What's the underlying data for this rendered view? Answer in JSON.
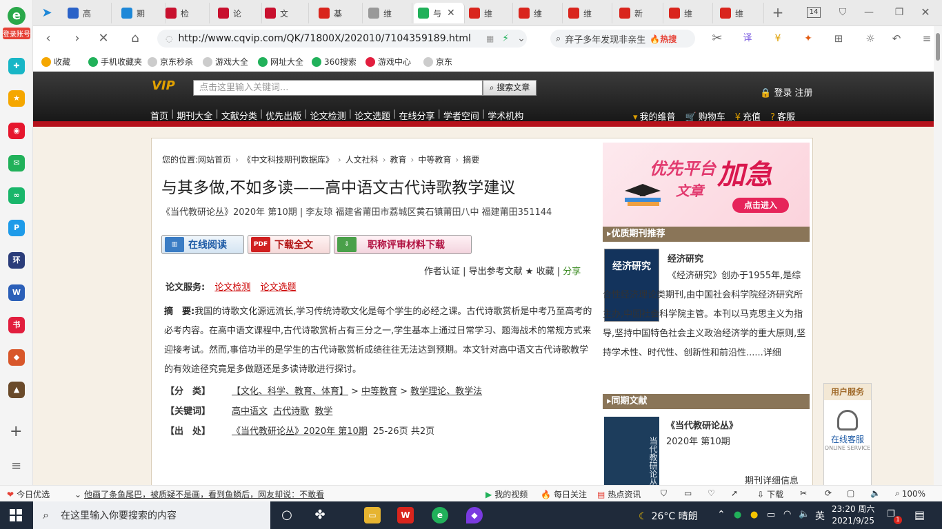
{
  "sidebar": {
    "account_label": "登录账号",
    "apps": [
      {
        "name": "translate",
        "color": "#18b6c6",
        "glyph": "✚"
      },
      {
        "name": "favorites",
        "color": "#f5a700",
        "glyph": "★"
      },
      {
        "name": "weibo",
        "color": "#e6162d",
        "glyph": "◉"
      },
      {
        "name": "mail",
        "color": "#21b15a",
        "glyph": "✉"
      },
      {
        "name": "link",
        "color": "#19b66a",
        "glyph": "∞"
      },
      {
        "name": "p-app",
        "color": "#1e9be9",
        "glyph": "P"
      },
      {
        "name": "huanqiu",
        "color": "#2b3d7a",
        "glyph": "环"
      },
      {
        "name": "word",
        "color": "#2b5fb8",
        "glyph": "W"
      },
      {
        "name": "xiaohongshu",
        "color": "#e21e3e",
        "glyph": "书"
      },
      {
        "name": "game1",
        "color": "#d8572a",
        "glyph": "◆"
      },
      {
        "name": "game2",
        "color": "#6a4a2a",
        "glyph": "▲"
      }
    ],
    "add_label": "+",
    "menu_label": "≡"
  },
  "tabs": [
    {
      "label": "高",
      "color": "#2a62c8"
    },
    {
      "label": "期",
      "color": "#1e88d8"
    },
    {
      "label": "检",
      "color": "#c8102e"
    },
    {
      "label": "论",
      "color": "#c8102e"
    },
    {
      "label": "文",
      "color": "#c8102e"
    },
    {
      "label": "基",
      "color": "#d9251d"
    },
    {
      "label": "维",
      "color": "#999999"
    },
    {
      "label": "与",
      "color": "#21b15a"
    },
    {
      "label": "维",
      "color": "#d9251d"
    },
    {
      "label": "维",
      "color": "#d9251d"
    },
    {
      "label": "维",
      "color": "#d9251d"
    },
    {
      "label": "新",
      "color": "#d9251d"
    },
    {
      "label": "维",
      "color": "#d9251d"
    },
    {
      "label": "维",
      "color": "#d9251d"
    }
  ],
  "tabbar": {
    "new_tab": "+",
    "tab_count": "14"
  },
  "address": {
    "url": "http://www.cqvip.com/QK/71800X/202010/7104359189.html",
    "search_text": "弃子多年发现非亲生",
    "hot_label": "🔥热搜"
  },
  "bookmarks": [
    {
      "label": "收藏",
      "color": "#f5a700"
    },
    {
      "label": "手机收藏夹",
      "color": "#21b15a"
    },
    {
      "label": "京东秒杀",
      "color": "#cccccc"
    },
    {
      "label": "游戏大全",
      "color": "#cccccc"
    },
    {
      "label": "网址大全",
      "color": "#21b15a"
    },
    {
      "label": "360搜索",
      "color": "#21b15a"
    },
    {
      "label": "游戏中心",
      "color": "#e21e3e"
    },
    {
      "label": "京东",
      "color": "#cccccc"
    }
  ],
  "site": {
    "logo": "VIP",
    "search_placeholder": "点击这里输入关键词...",
    "search_button": "搜索文章",
    "login": "登录",
    "register": "注册",
    "nav": [
      "首页",
      "期刊大全",
      "文献分类",
      "优先出版",
      "论文检测",
      "论文选题",
      "在线分享",
      "学者空间",
      "学术机构"
    ],
    "user_nav": [
      "我的维普",
      "购物车",
      "充值",
      "客服"
    ]
  },
  "article": {
    "breadcrumb_prefix": "您的位置:",
    "breadcrumb": [
      "网站首页",
      "《中文科技期刊数据库》",
      "人文社科",
      "教育",
      "中等教育",
      "摘要"
    ],
    "title": "与其多做,不如多读——高中语文古代诗歌教学建议",
    "source_line": "《当代教研论丛》2020年 第10期 | 李友琼   福建省莆田市荔城区黄石镇莆田八中 福建莆田351144",
    "buttons": {
      "read": "在线阅读",
      "download": "下载全文",
      "materials": "职称评审材料下载"
    },
    "action_links": "作者认证 | 导出参考文献 ★ 收藏 |",
    "share": "分享",
    "service_label": "论文服务:",
    "service_links": [
      "论文检测",
      "论文选题"
    ],
    "abstract_label": "摘　要:",
    "abstract": "我国的诗歌文化源远流长,学习传统诗歌文化是每个学生的必经之课。古代诗歌赏析是中考乃至高考的必考内容。在高中语文课程中,古代诗歌赏析占有三分之一,学生基本上通过日常学习、题海战术的常规方式来迎接考试。然而,事倍功半的是学生的古代诗歌赏析成绩往往无法达到预期。本文针对高中语文古代诗歌教学的有效途径究竟是多做题还是多读诗歌进行探讨。",
    "classification_label": "【分　类】",
    "classification": [
      "【文化、科学、教育、体育】",
      "中等教育",
      "教学理论、教学法"
    ],
    "keywords_label": "【关键词】",
    "keywords": [
      "高中语文",
      "古代诗歌",
      "教学"
    ],
    "origin_label": "【出　处】",
    "origin_link": "《当代教研论丛》2020年 第10期",
    "origin_pages": "25-26页 共2页"
  },
  "right": {
    "ad": {
      "line1": "优先平台",
      "line2": "加急",
      "line3": "文章",
      "button": "点击进入"
    },
    "recommend_head": "优质期刊推荐",
    "journal1_cover": "经济研究",
    "journal1_name": "经济研究",
    "journal1_desc": "《经济研究》创办于1955年,是综合性经济理论类期刊,由中国社会科学院经济研究所主办,中国社会科学院主管。本刊以马克思主义为指导,坚持中国特色社会主义政治经济学的重大原则,坚持学术性、时代性、创新性和前沿性......详细",
    "same_head": "同期文献",
    "journal2_cover": "当代教研论丛",
    "journal2_name": "《当代教研论丛》",
    "journal2_issue": "2020年 第10期",
    "journal2_more": "期刊详细信息"
  },
  "cs_float": {
    "head": "用户服务",
    "title": "在线客服",
    "sub": "ONLINE SERVICE"
  },
  "statusbar": {
    "daily": "今日优选",
    "news": "他画了条鱼尾巴，被质疑不是画，看到鱼鳞后，网友却说：不敢看",
    "video": "我的视频",
    "daily_focus": "每日关注",
    "hot_news": "热点资讯",
    "download": "下载",
    "zoom": "100%"
  },
  "taskbar": {
    "search_placeholder": "在这里输入你要搜索的内容",
    "weather": "26°C 晴朗",
    "lang": "英",
    "time": "23:20 周六",
    "date": "2021/9/25",
    "notifications": "1"
  }
}
